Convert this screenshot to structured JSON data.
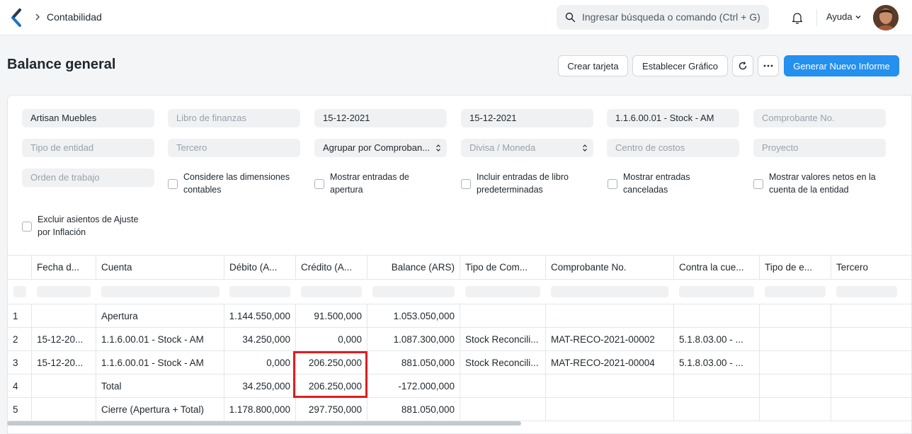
{
  "navbar": {
    "breadcrumb": "Contabilidad",
    "search_placeholder": "Ingresar búsqueda o comando (Ctrl + G)",
    "help_label": "Ayuda"
  },
  "page": {
    "title": "Balance general",
    "buttons": {
      "create_card": "Crear tarjeta",
      "set_chart": "Establecer Gráfico",
      "generate_report": "Generar Nuevo Informe"
    }
  },
  "filters": {
    "company": "Artisan Muebles",
    "finance_book": "Libro de finanzas",
    "from_date": "15-12-2021",
    "to_date": "15-12-2021",
    "account": "1.1.6.00.01 - Stock - AM",
    "voucher_no": "Comprobante No.",
    "party_type": "Tipo de entidad",
    "party": "Tercero",
    "group_by": "Agrupar por Comproban...",
    "currency": "Divisa / Moneda",
    "cost_center": "Centro de costos",
    "project": "Proyecto",
    "work_order": "Orden de trabajo",
    "check_dimensions": "Considere las dimensiones contables",
    "check_opening": "Mostrar entradas de apertura",
    "check_default_book": "Incluir entradas de libro predeterminadas",
    "check_cancelled": "Mostrar entradas canceladas",
    "check_net_values": "Mostrar valores netos en la cuenta de la entidad",
    "check_inflation": "Excluir asientos de Ajuste por Inflación"
  },
  "table": {
    "columns": [
      "Fecha d...",
      "Cuenta",
      "Débito (A...",
      "Crédito (A...",
      "Balance (ARS)",
      "Tipo de Com...",
      "Comprobante No.",
      "Contra la cue...",
      "Tipo de e...",
      "Tercero"
    ],
    "rows": [
      {
        "num": "1",
        "date": "",
        "account": "Apertura",
        "debit": "1.144.550,000",
        "credit": "91.500,000",
        "balance": "1.053.050,000",
        "vtype": "",
        "vno": "",
        "against": ""
      },
      {
        "num": "2",
        "date": "15-12-20...",
        "account": "1.1.6.00.01 - Stock - AM",
        "debit": "34.250,000",
        "credit": "0,000",
        "balance": "1.087.300,000",
        "vtype": "Stock Reconcili...",
        "vno": "MAT-RECO-2021-00002",
        "against": "5.1.8.03.00 - ..."
      },
      {
        "num": "3",
        "date": "15-12-20...",
        "account": "1.1.6.00.01 - Stock - AM",
        "debit": "0,000",
        "credit": "206.250,000",
        "balance": "881.050,000",
        "vtype": "Stock Reconcili...",
        "vno": "MAT-RECO-2021-00004",
        "against": "5.1.8.03.00 - ..."
      },
      {
        "num": "4",
        "date": "",
        "account": "Total",
        "debit": "34.250,000",
        "credit": "206.250,000",
        "balance": "-172.000,000",
        "vtype": "",
        "vno": "",
        "against": ""
      },
      {
        "num": "5",
        "date": "",
        "account": "Cierre (Apertura + Total)",
        "debit": "1.178.800,000",
        "credit": "297.750,000",
        "balance": "881.050,000",
        "vtype": "",
        "vno": "",
        "against": ""
      }
    ]
  },
  "colors": {
    "primary": "#2490ef",
    "highlight": "#e11d1d"
  }
}
